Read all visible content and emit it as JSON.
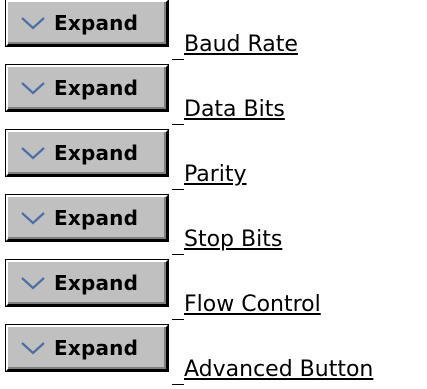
{
  "header": {
    "fragment": "g"
  },
  "rows": [
    {
      "button_label": "Expand",
      "link_label": "Baud Rate"
    },
    {
      "button_label": "Expand",
      "link_label": "Data Bits"
    },
    {
      "button_label": "Expand",
      "link_label": "Parity"
    },
    {
      "button_label": "Expand",
      "link_label": "Stop Bits"
    },
    {
      "button_label": "Expand",
      "link_label": "Flow Control"
    },
    {
      "button_label": "Expand",
      "link_label": "Advanced Button"
    }
  ],
  "colors": {
    "button_face": "#c0c0c0",
    "chevron": "#4a6fa5",
    "text": "#000000"
  },
  "icons": {
    "expand_icon": "chevron-down-icon"
  }
}
